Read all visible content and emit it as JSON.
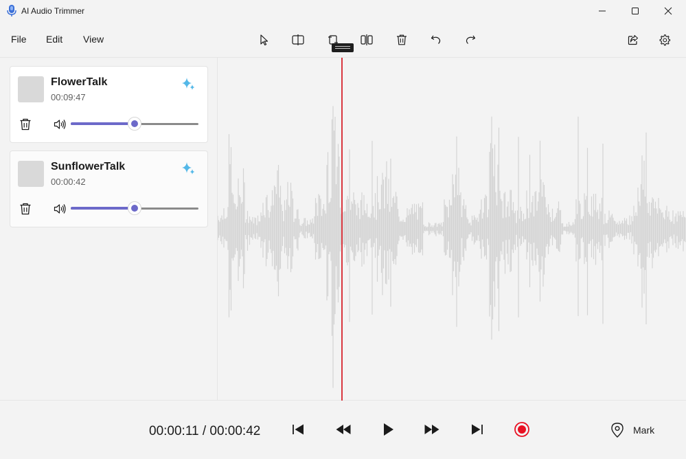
{
  "window": {
    "title": "AI Audio Trimmer",
    "icon": "microphone-icon"
  },
  "menu": {
    "file": "File",
    "edit": "Edit",
    "view": "View"
  },
  "toolbar": {
    "icons": [
      "select-pointer-icon",
      "split-icon",
      "trim-icon",
      "split-columns-icon",
      "delete-icon",
      "undo-icon",
      "redo-icon",
      "share-icon",
      "gear-icon"
    ]
  },
  "tracks": [
    {
      "name": "FlowerTalk",
      "duration": "00:09:47",
      "volume": 0.5
    },
    {
      "name": "SunflowerTalk",
      "duration": "00:00:42",
      "volume": 0.5
    }
  ],
  "playback": {
    "time_readout": "00:00:11 / 00:00:42",
    "position_fraction": 0.26
  },
  "transport": {
    "mark_label": "Mark"
  },
  "colors": {
    "accent": "#6c69c9",
    "playhead": "#d9363e",
    "record": "#e81123",
    "waveform": "#d3d3d3"
  }
}
